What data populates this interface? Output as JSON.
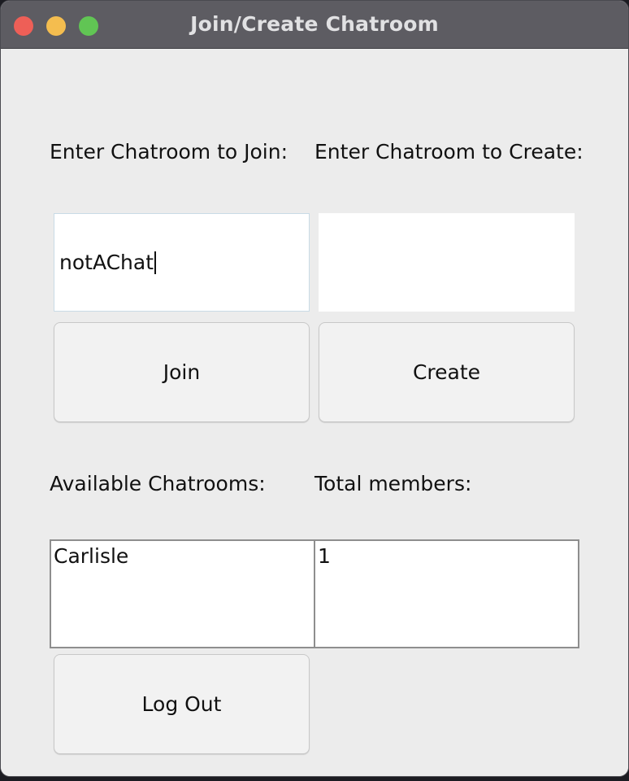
{
  "window": {
    "title": "Join/Create Chatroom"
  },
  "join": {
    "label": "Enter Chatroom to Join:",
    "input_value": "notAChat",
    "button_label": "Join"
  },
  "create": {
    "label": "Enter Chatroom to Create:",
    "input_value": "",
    "button_label": "Create"
  },
  "chatrooms": {
    "label": "Available Chatrooms:",
    "items": [
      "Carlisle"
    ]
  },
  "members": {
    "label": "Total members:",
    "items": [
      "1"
    ]
  },
  "logout": {
    "button_label": "Log Out"
  }
}
